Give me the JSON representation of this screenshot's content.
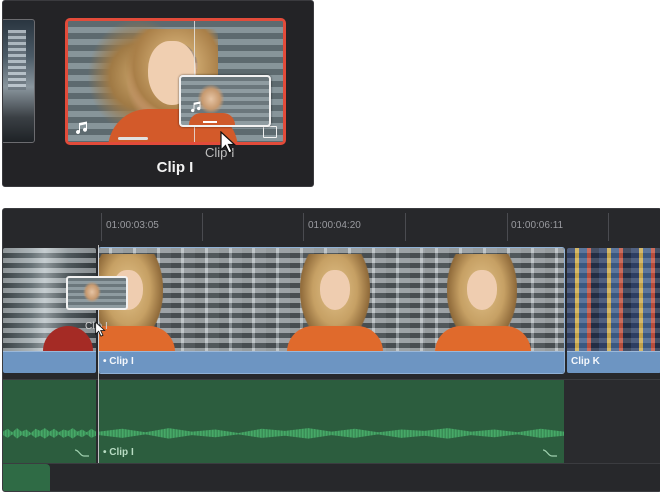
{
  "media_pool": {
    "selected_clip_name": "Clip I",
    "drag_ghost_label": "Clip I"
  },
  "timeline": {
    "timecodes": [
      "01:00:03:05",
      "01:00:04:20",
      "01:00:06:11"
    ],
    "video_clips": [
      {
        "name": ""
      },
      {
        "name": "• Clip I"
      },
      {
        "name": "Clip K"
      }
    ],
    "audio_clips": [
      {
        "name": ""
      },
      {
        "name": "• Clip I"
      }
    ],
    "drag_ghost_label": "Clip I"
  },
  "colors": {
    "selection_border": "#e24b3a",
    "video_clip_bar": "#6d95c2",
    "audio_clip": "#2c5d3e"
  },
  "icons": [
    "music-note-icon",
    "clip-type-icon",
    "mouse-cursor-icon",
    "audio-fade-icon"
  ]
}
